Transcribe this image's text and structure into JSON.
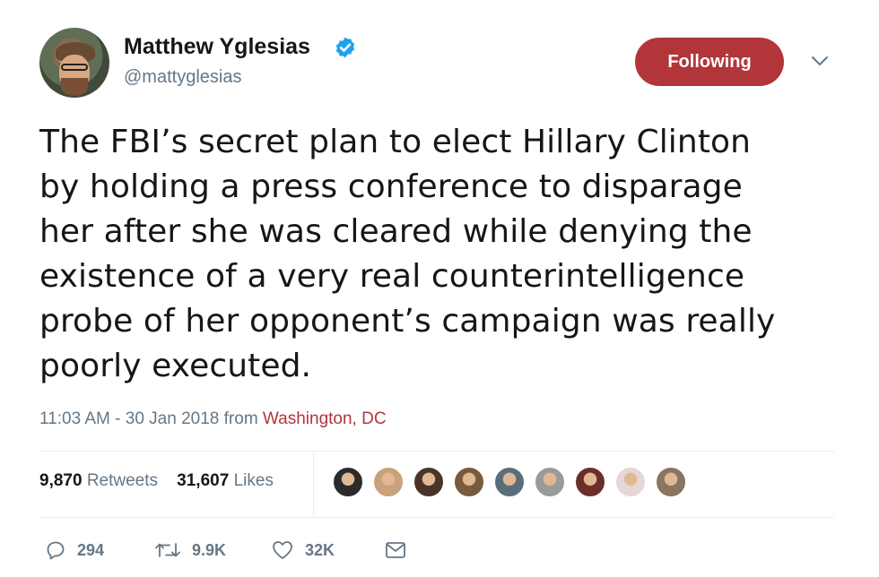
{
  "author": {
    "display_name": "Matthew Yglesias",
    "handle": "@mattyglesias",
    "verified": true
  },
  "follow_button": {
    "label": "Following",
    "color": "#b2353a"
  },
  "tweet": {
    "lines": [
      "The FBI’s secret plan to elect Hillary Clinton",
      "by holding a press conference to disparage",
      "her after she was cleared while denying the",
      "existence of a very real counterintelligence",
      "probe of her opponent’s campaign was really",
      "poorly executed."
    ]
  },
  "meta": {
    "timestamp": "11:03 AM - 30 Jan 2018",
    "from_label": "from",
    "location": "Washington, DC"
  },
  "stats": {
    "retweets_count": "9,870",
    "retweets_label": "Retweets",
    "likes_count": "31,607",
    "likes_label": "Likes"
  },
  "liker_avatars": [
    {
      "name": "liker-avatar-1",
      "color": "#2b2b2b"
    },
    {
      "name": "liker-avatar-2",
      "color": "#c8a27a"
    },
    {
      "name": "liker-avatar-3",
      "color": "#4a3328"
    },
    {
      "name": "liker-avatar-4",
      "color": "#7a5a3c"
    },
    {
      "name": "liker-avatar-5",
      "color": "#5a6e7a"
    },
    {
      "name": "liker-avatar-6",
      "color": "#9a9a9a"
    },
    {
      "name": "liker-avatar-7",
      "color": "#6b2f2a"
    },
    {
      "name": "liker-avatar-8",
      "color": "#e7d6d6"
    },
    {
      "name": "liker-avatar-9",
      "color": "#8a7560"
    }
  ],
  "actions": {
    "reply_count": "294",
    "retweet_count": "9.9K",
    "like_count": "32K"
  },
  "colors": {
    "accent": "#b2353a",
    "verified": "#1da1f2",
    "muted": "#657786"
  },
  "icons": [
    "verified-badge-icon",
    "chevron-down-icon",
    "reply-icon",
    "retweet-icon",
    "heart-icon",
    "message-icon"
  ]
}
